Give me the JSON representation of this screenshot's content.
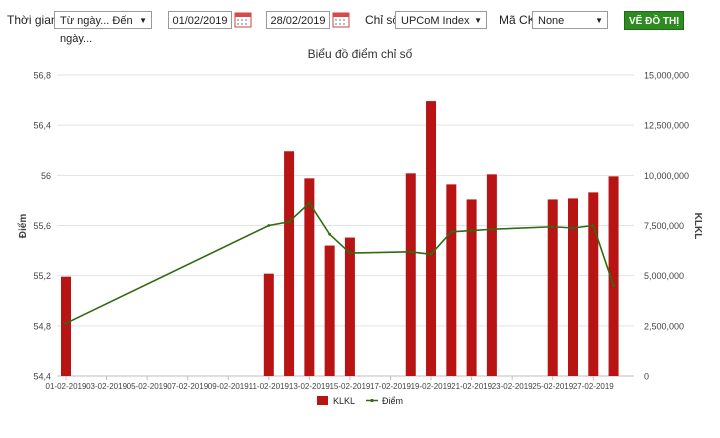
{
  "toolbar": {
    "time_label": "Thời gian",
    "time_select": "Từ ngày... Đến ngày...",
    "from_date": "01/02/2019",
    "to_date": "28/02/2019",
    "index_label": "Chỉ số",
    "index_select": "UPCoM Index",
    "code_label": "Mã CK",
    "code_select": "None",
    "draw_button": "VẼ ĐỒ THỊ"
  },
  "colors": {
    "bar": "#b81414",
    "line": "#2e6b12",
    "button": "#2e8b1f"
  },
  "chart_data": {
    "type": "bar",
    "title": "Biểu đồ điểm chỉ số",
    "ylabel": "Điểm",
    "y2label": "KLKL",
    "y_ticks": [
      "56,8",
      "56,4",
      "56",
      "55,6",
      "55,2",
      "54,8",
      "54,4"
    ],
    "y2_ticks": [
      "15,000,000",
      "12,500,000",
      "10,000,000",
      "7,500,000",
      "5,000,000",
      "2,500,000",
      "0"
    ],
    "ylim": [
      54.4,
      56.8
    ],
    "y2lim": [
      0,
      15000000
    ],
    "x_ticks": [
      "01-02-2019",
      "03-02-2019",
      "05-02-2019",
      "07-02-2019",
      "09-02-2019",
      "11-02-2019",
      "13-02-2019",
      "15-02-2019",
      "17-02-2019",
      "19-02-2019",
      "21-02-2019",
      "23-02-2019",
      "25-02-2019",
      "27-02-2019"
    ],
    "grid": true,
    "legend_position": "bottom",
    "series": [
      {
        "name": "KLKL",
        "type": "bar",
        "axis": "right",
        "x": [
          1,
          11,
          12,
          13,
          14,
          15,
          18,
          19,
          20,
          21,
          22,
          25,
          26,
          27,
          28
        ],
        "values": [
          4950000,
          5100000,
          11200000,
          9850000,
          6500000,
          6900000,
          10100000,
          13700000,
          9550000,
          8800000,
          10050000,
          8800000,
          8850000,
          9150000,
          9950000
        ]
      },
      {
        "name": "Điểm",
        "type": "line",
        "axis": "left",
        "x": [
          1,
          11,
          12,
          13,
          14,
          15,
          18,
          19,
          20,
          21,
          22,
          25,
          26,
          27,
          28
        ],
        "values": [
          54.82,
          55.6,
          55.63,
          55.78,
          55.53,
          55.38,
          55.39,
          55.37,
          55.55,
          55.56,
          55.57,
          55.59,
          55.58,
          55.6,
          55.12
        ]
      }
    ]
  }
}
